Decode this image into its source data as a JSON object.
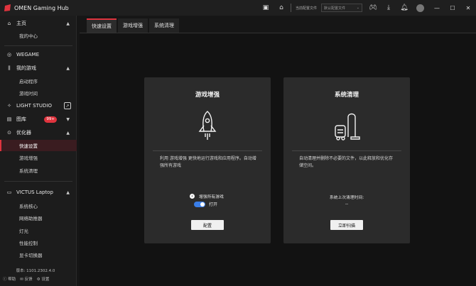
{
  "titlebar": {
    "title": "OMEN Gaming Hub",
    "profile_label": "当前配置文件",
    "profile_value": "默认配置文件"
  },
  "sidebar": {
    "home": "主页",
    "my_center": "我的中心",
    "wegame": "WEGAME",
    "my_games": "我的游戏",
    "launcher": "启动程序",
    "game_time": "游戏时间",
    "light_studio": "LIGHT STUDIO",
    "gallery": "图库",
    "gallery_badge": "99+",
    "optimizer": "优化器",
    "quick_settings": "快速设置",
    "game_boost": "游戏增强",
    "system_clean": "系统清理",
    "victus": "VICTUS Laptop",
    "system_core": "系统核心",
    "network_booster": "网络助推器",
    "lighting": "灯光",
    "performance": "性能控制",
    "graphics_switcher": "显卡切换器",
    "version": "版本: 1101.2302.4.0",
    "help": "帮助",
    "feedback": "反馈",
    "settings": "设置"
  },
  "tabs": [
    "快速设置",
    "游戏增强",
    "系统清理"
  ],
  "boost_card": {
    "title": "游戏增强",
    "description": "利用 游戏增强 更快地运行游戏和应用程序。自动增强所有游戏",
    "check_label": "增强所有游戏",
    "toggle_label": "打开",
    "button": "配置"
  },
  "clean_card": {
    "title": "系统清理",
    "description": "自动清理并删除不必要的文件，以此释放和优化存储空间。",
    "last_clean_label": "系统上次清理时间:",
    "last_clean_value": "--",
    "button": "立即扫描"
  },
  "colors": {
    "accent": "#e0343e",
    "toggle": "#3a7ee8"
  }
}
